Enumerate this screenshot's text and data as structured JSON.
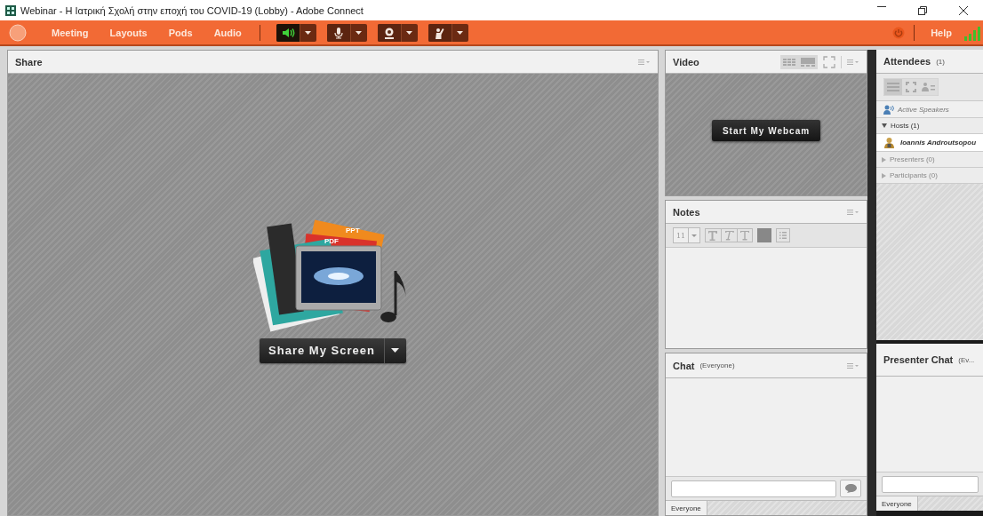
{
  "window": {
    "title": "Webinar - Η Ιατρική Σχολή στην εποχή του COVID-19 (Lobby) - Adobe Connect"
  },
  "menubar": {
    "menus": [
      "Meeting",
      "Layouts",
      "Pods",
      "Audio"
    ],
    "toolbar": [
      {
        "kind": "speaker",
        "on": true
      },
      {
        "kind": "microphone",
        "on": false
      },
      {
        "kind": "webcam",
        "on": false
      },
      {
        "kind": "raise-hand",
        "on": false
      }
    ],
    "help": "Help"
  },
  "share_pod": {
    "title": "Share",
    "illustration_labels": [
      "PPT",
      "PDF"
    ],
    "button": "Share My Screen"
  },
  "video_pod": {
    "title": "Video",
    "button": "Start My Webcam"
  },
  "notes_pod": {
    "title": "Notes",
    "font_size": "11"
  },
  "chat_pod": {
    "title": "Chat",
    "scope": "(Everyone)",
    "tab": "Everyone"
  },
  "attendees_pod": {
    "title": "Attendees",
    "count": "(1)",
    "active_speakers": "Active Speakers",
    "groups": [
      {
        "label": "Hosts (1)",
        "expanded": true,
        "children": [
          {
            "name": "Ioannis Androutsopou"
          }
        ]
      },
      {
        "label": "Presenters (0)",
        "expanded": false
      },
      {
        "label": "Participants (0)",
        "expanded": false
      }
    ]
  },
  "presenter_chat_pod": {
    "title": "Presenter Chat",
    "scope": "(Ev...",
    "tab": "Everyone"
  }
}
